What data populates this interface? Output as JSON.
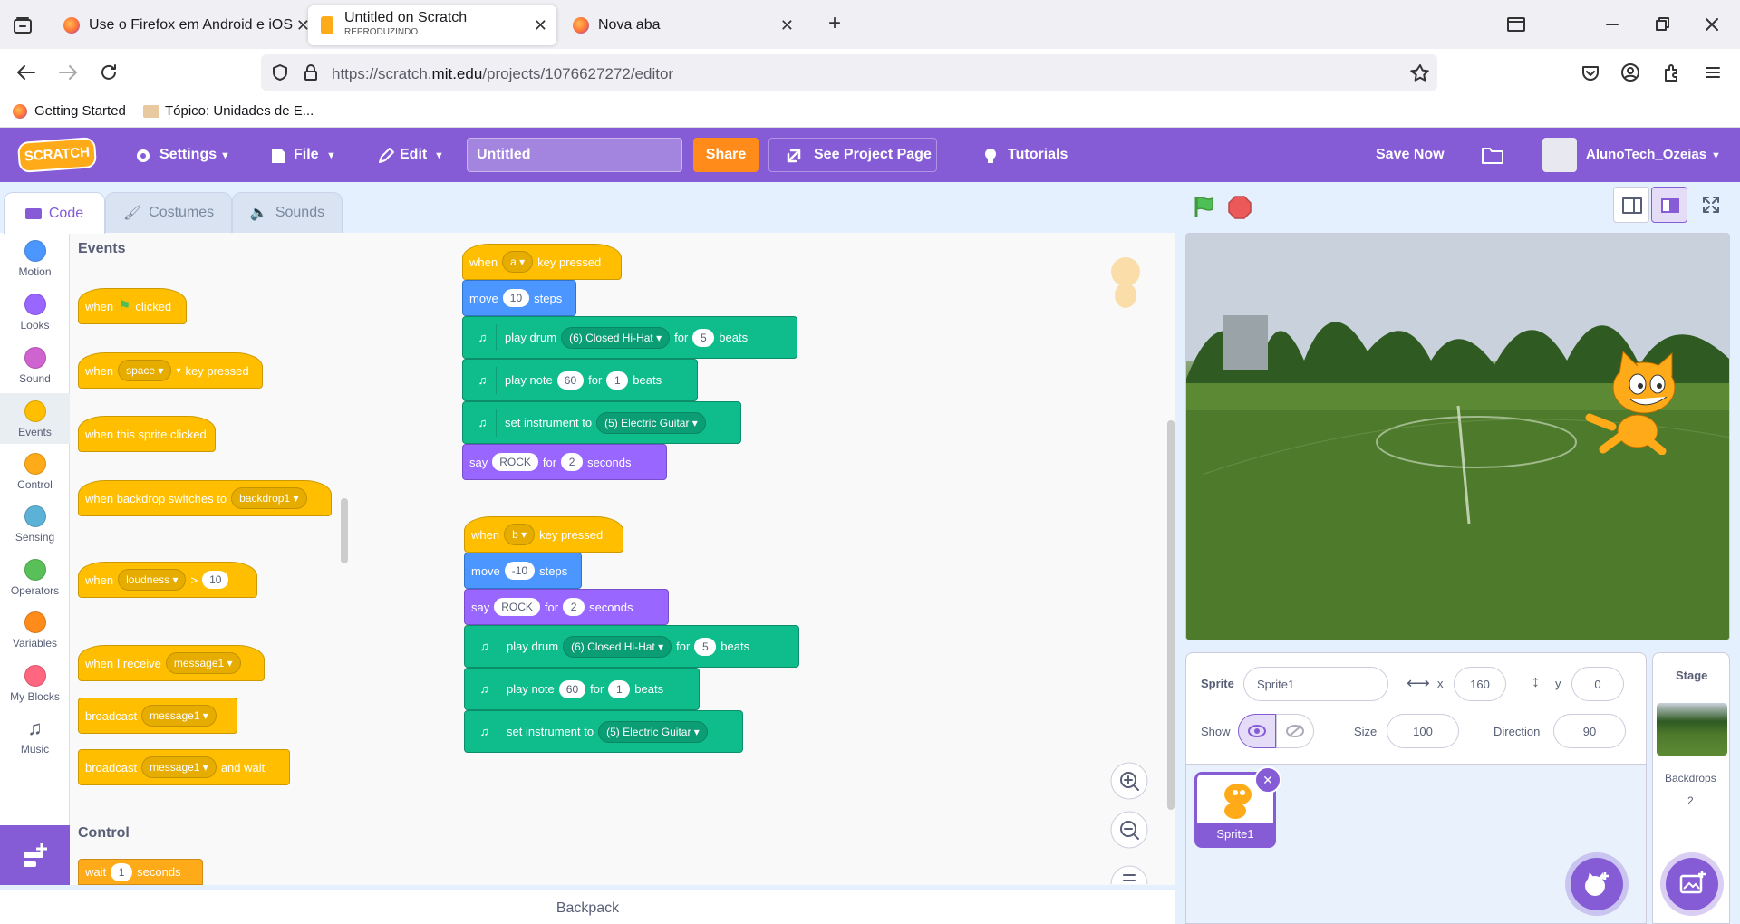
{
  "browser": {
    "tabs": [
      {
        "title": "Use o Firefox em Android e iOS"
      },
      {
        "title": "Untitled on Scratch",
        "subtitle": "REPRODUZINDO"
      },
      {
        "title": "Nova aba"
      }
    ],
    "url_prefix": "https://scratch.",
    "url_domain": "mit.edu",
    "url_path": "/projects/1076627272/editor",
    "bookmarks": [
      "Getting Started",
      "Tópico: Unidades de E..."
    ]
  },
  "menu": {
    "logo": "SCRATCH",
    "settings": "Settings",
    "file": "File",
    "edit": "Edit",
    "project_title": "Untitled",
    "share": "Share",
    "see_project": "See Project Page",
    "tutorials": "Tutorials",
    "save_now": "Save Now",
    "username": "AlunoTech_Ozeias"
  },
  "editor_tabs": {
    "code": "Code",
    "costumes": "Costumes",
    "sounds": "Sounds"
  },
  "categories": [
    {
      "label": "Motion",
      "color": "#4c97ff"
    },
    {
      "label": "Looks",
      "color": "#9966ff"
    },
    {
      "label": "Sound",
      "color": "#cf63cf"
    },
    {
      "label": "Events",
      "color": "#ffbf00"
    },
    {
      "label": "Control",
      "color": "#ffab19"
    },
    {
      "label": "Sensing",
      "color": "#5cb1d6"
    },
    {
      "label": "Operators",
      "color": "#59c059"
    },
    {
      "label": "Variables",
      "color": "#ff8c1a"
    },
    {
      "label": "My Blocks",
      "color": "#ff6680"
    },
    {
      "label": "Music",
      "color": "#0fbd8c"
    }
  ],
  "palette": {
    "events_heading": "Events",
    "b1_when": "when",
    "b1_clicked": "clicked",
    "b2_when": "when",
    "b2_key": "space",
    "b2_tail": "key pressed",
    "b3": "when this sprite clicked",
    "b4_text": "when backdrop switches to",
    "b4_dd": "backdrop1",
    "b5_when": "when",
    "b5_dd": "loudness",
    "b5_op": ">",
    "b5_num": "10",
    "b6_text": "when I receive",
    "b6_dd": "message1",
    "b7_text": "broadcast",
    "b7_dd": "message1",
    "b8_text": "broadcast",
    "b8_dd": "message1",
    "b8_tail": "and wait",
    "control_heading": "Control",
    "c1_text": "wait",
    "c1_num": "1",
    "c1_tail": "seconds"
  },
  "script1": {
    "hat_when": "when",
    "hat_key": "a",
    "hat_tail": "key pressed",
    "move": "move",
    "move_num": "10",
    "move_tail": "steps",
    "drum": "play drum",
    "drum_dd": "(6) Closed Hi-Hat",
    "drum_for": "for",
    "drum_num": "5",
    "drum_tail": "beats",
    "note": "play note",
    "note_num": "60",
    "note_for": "for",
    "note_beats": "1",
    "note_tail": "beats",
    "inst": "set instrument to",
    "inst_dd": "(5) Electric Guitar",
    "say": "say",
    "say_text": "ROCK",
    "say_for": "for",
    "say_num": "2",
    "say_tail": "seconds"
  },
  "script2": {
    "hat_when": "when",
    "hat_key": "b",
    "hat_tail": "key pressed",
    "move": "move",
    "move_num": "-10",
    "move_tail": "steps",
    "say": "say",
    "say_text": "ROCK",
    "say_for": "for",
    "say_num": "2",
    "say_tail": "seconds",
    "drum": "play drum",
    "drum_dd": "(6) Closed Hi-Hat",
    "drum_for": "for",
    "drum_num": "5",
    "drum_tail": "beats",
    "note": "play note",
    "note_num": "60",
    "note_for": "for",
    "note_beats": "1",
    "note_tail": "beats",
    "inst": "set instrument to",
    "inst_dd": "(5) Electric Guitar"
  },
  "backpack": "Backpack",
  "sprite": {
    "label": "Sprite",
    "name": "Sprite1",
    "x_label": "x",
    "x": "160",
    "y_label": "y",
    "y": "0",
    "show_label": "Show",
    "size_label": "Size",
    "size": "100",
    "direction_label": "Direction",
    "direction": "90",
    "thumb_name": "Sprite1"
  },
  "stage_panel": {
    "title": "Stage",
    "backdrops_label": "Backdrops",
    "backdrops_count": "2"
  }
}
